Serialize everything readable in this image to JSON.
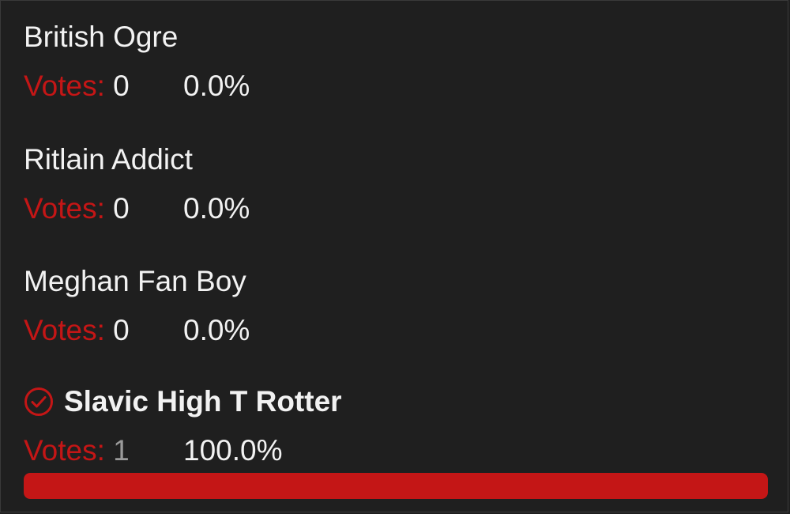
{
  "poll": {
    "votes_label": "Votes:",
    "accent_color": "#c41616",
    "options": [
      {
        "name": "British Ogre",
        "votes": "0",
        "percent": "0.0%",
        "selected": false
      },
      {
        "name": "Ritlain Addict",
        "votes": "0",
        "percent": "0.0%",
        "selected": false
      },
      {
        "name": "Meghan Fan Boy",
        "votes": "0",
        "percent": "0.0%",
        "selected": false
      },
      {
        "name": "Slavic High T Rotter",
        "votes": "1",
        "percent": "100.0%",
        "selected": true,
        "icon": "check-circle-icon",
        "progress": 1.0
      }
    ]
  }
}
